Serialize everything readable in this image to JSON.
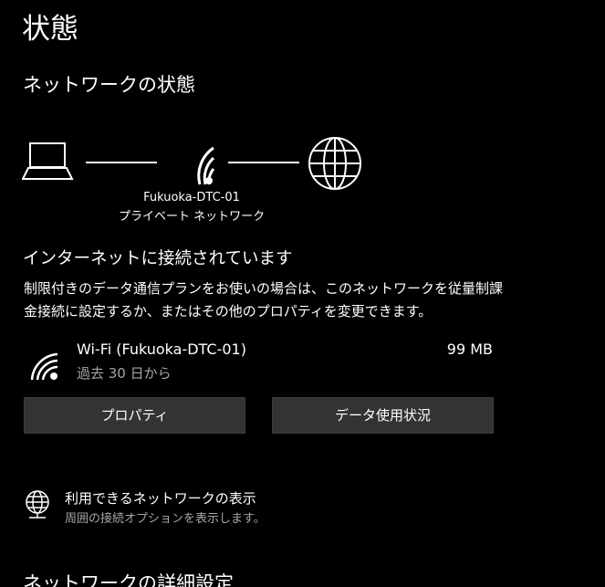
{
  "page": {
    "title": "状態"
  },
  "network_status": {
    "section_title": "ネットワークの状態",
    "network_name": "Fukuoka-DTC-01",
    "network_type": "プライベート ネットワーク",
    "connection_status": "インターネットに接続されています",
    "description": "制限付きのデータ通信プランをお使いの場合は、このネットワークを従量制課金接続に設定するか、またはその他のプロパティを変更できます。",
    "icons": [
      "laptop-icon",
      "wifi-icon",
      "globe-icon"
    ]
  },
  "connection": {
    "name": "Wi-Fi (Fukuoka-DTC-01)",
    "period": "過去 30 日から",
    "usage": "99 MB",
    "icon": "wifi-icon"
  },
  "buttons": {
    "properties": "プロパティ",
    "data_usage": "データ使用状況"
  },
  "available_networks": {
    "title": "利用できるネットワークの表示",
    "subtitle": "周囲の接続オプションを表示します。",
    "icon": "network-globe-icon"
  },
  "advanced": {
    "section_title": "ネットワークの詳細設定"
  },
  "colors": {
    "background": "#000000",
    "text": "#ffffff",
    "secondary_text": "#a6a6a6",
    "button": "#333333"
  }
}
